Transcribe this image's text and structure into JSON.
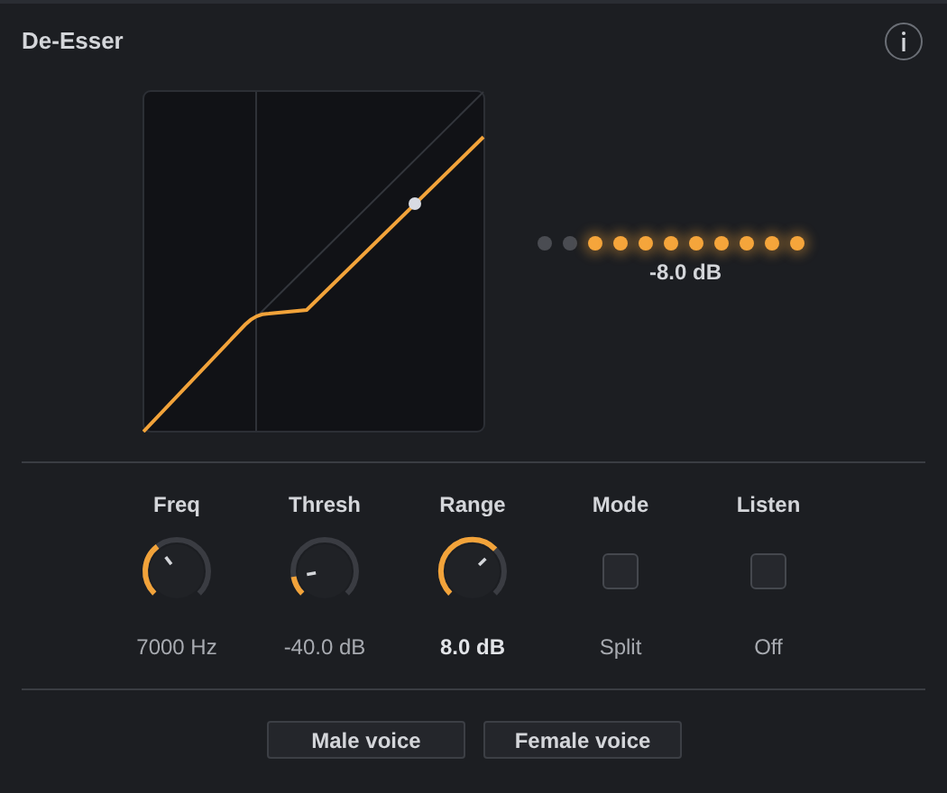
{
  "title": "De-Esser",
  "meter": {
    "dots": [
      {
        "lit": false
      },
      {
        "lit": false
      },
      {
        "lit": true
      },
      {
        "lit": true
      },
      {
        "lit": true
      },
      {
        "lit": true
      },
      {
        "lit": true
      },
      {
        "lit": true
      },
      {
        "lit": true
      },
      {
        "lit": true
      },
      {
        "lit": true
      }
    ],
    "reading": "-8.0 dB"
  },
  "controls": [
    {
      "kind": "knob",
      "label": "Freq",
      "value": "7000 Hz",
      "emphasized": false
    },
    {
      "kind": "knob",
      "label": "Thresh",
      "value": "-40.0 dB",
      "emphasized": false
    },
    {
      "kind": "knob",
      "label": "Range",
      "value": "8.0 dB",
      "emphasized": true
    },
    {
      "kind": "toggle",
      "label": "Mode",
      "checked": false,
      "value": "Split"
    },
    {
      "kind": "toggle",
      "label": "Listen",
      "checked": false,
      "value": "Off"
    }
  ],
  "presets": [
    "Male voice",
    "Female voice"
  ]
}
